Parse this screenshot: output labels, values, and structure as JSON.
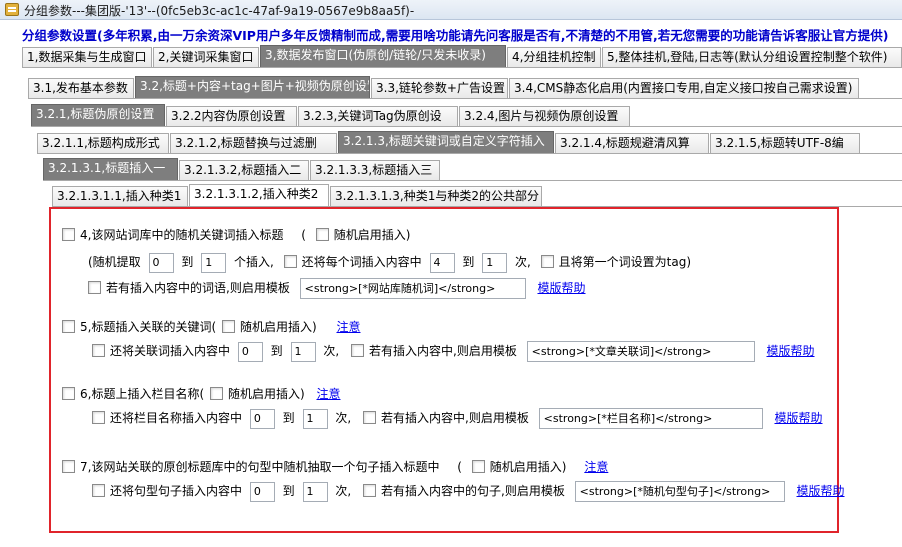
{
  "window": {
    "title": "分组参数---集团版-'13'--(0fc5eb3c-ac1c-47af-9a19-0567e9b8aa5f)-"
  },
  "notice": "分组参数设置(多年积累,由一万余资深VIP用户多年反馈精制而成,需要用啥功能请先问客服是否有,不清楚的不用管,若无您需要的功能请告诉客服让官方提供)",
  "tabs_l1": [
    "1,数据采集与生成窗口",
    "2,关键词采集窗口",
    "3,数据发布窗口(伪原创/链轮/只发未收录)",
    "4,分组挂机控制",
    "5,整体挂机,登陆,日志等(默认分组设置控制整个软件)"
  ],
  "tabs_l2": [
    "3.1,发布基本参数",
    "3.2,标题+内容+tag+图片+视频伪原创设置",
    "3.3,链轮参数+广告设置",
    "3.4,CMS静态化启用(内置接口专用,自定义接口按自己需求设置)"
  ],
  "tabs_l3": [
    "3.2.1,标题伪原创设置",
    "3.2.2内容伪原创设置",
    "3.2.3,关键词Tag伪原创设",
    "3.2.4,图片与视频伪原创设置"
  ],
  "tabs_l4": [
    "3.2.1.1,标题构成形式",
    "3.2.1.2,标题替换与过滤删",
    "3.2.1.3,标题关键词或自定义字符插入",
    "3.2.1.4,标题规避清风算",
    "3.2.1.5,标题转UTF-8编"
  ],
  "tabs_l5": [
    "3.2.1.3.1,标题插入一",
    "3.2.1.3.2,标题插入二",
    "3.2.1.3.3,标题插入三"
  ],
  "tabs_l6": [
    "3.2.1.3.1.1,插入种类1",
    "3.2.1.3.1.2,插入种类2",
    "3.2.1.3.1.3,种类1与种类2的公共部分"
  ],
  "section4": {
    "title": "4,该网站词库中的随机关键词插入标题",
    "open_paren": "(",
    "random_label": "随机启用插入)",
    "extract_prefix": "(随机提取",
    "extract_min": "0",
    "to1": "到",
    "extract_max": "1",
    "extract_suffix": "个插入,",
    "each_label": "还将每个词插入内容中",
    "each_min": "4",
    "to2": "到",
    "each_max": "1",
    "times": "次,",
    "first_tag_label": "且将第一个词设置为tag)",
    "template_label": "若有插入内容中的词语,则启用模板",
    "template_value": "<strong>[*网站库随机词]</strong>",
    "help": "模版帮助"
  },
  "section5": {
    "title": "5,标题插入关联的关键词(",
    "random_label": "随机启用插入)",
    "note": "注意",
    "insert_label": "还将关联词插入内容中",
    "min": "0",
    "to": "到",
    "max": "1",
    "times": "次,",
    "template_label": "若有插入内容中,则启用模板",
    "template_value": "<strong>[*文章关联词]</strong>",
    "help": "模版帮助"
  },
  "section6": {
    "title": "6,标题上插入栏目名称(",
    "random_label": "随机启用插入)",
    "note": "注意",
    "insert_label": "还将栏目名称插入内容中",
    "min": "0",
    "to": "到",
    "max": "1",
    "times": "次,",
    "template_label": "若有插入内容中,则启用模板",
    "template_value": "<strong>[*栏目名称]</strong>",
    "help": "模版帮助"
  },
  "section7": {
    "title": "7,该网站关联的原创标题库中的句型中随机抽取一个句子插入标题中",
    "open_paren": "(",
    "random_label": "随机启用插入)",
    "note": "注意",
    "insert_label": "还将句型句子插入内容中",
    "min": "0",
    "to": "到",
    "max": "1",
    "times": "次,",
    "template_label": "若有插入内容中的句子,则启用模板",
    "template_value": "<strong>[*随机句型句子]</strong>",
    "help": "模版帮助"
  },
  "colors": {
    "highlight_border": "#e0242b",
    "active_tab": "#7e7e7e",
    "notice_text": "#0000cc",
    "link": "#0000ee"
  }
}
